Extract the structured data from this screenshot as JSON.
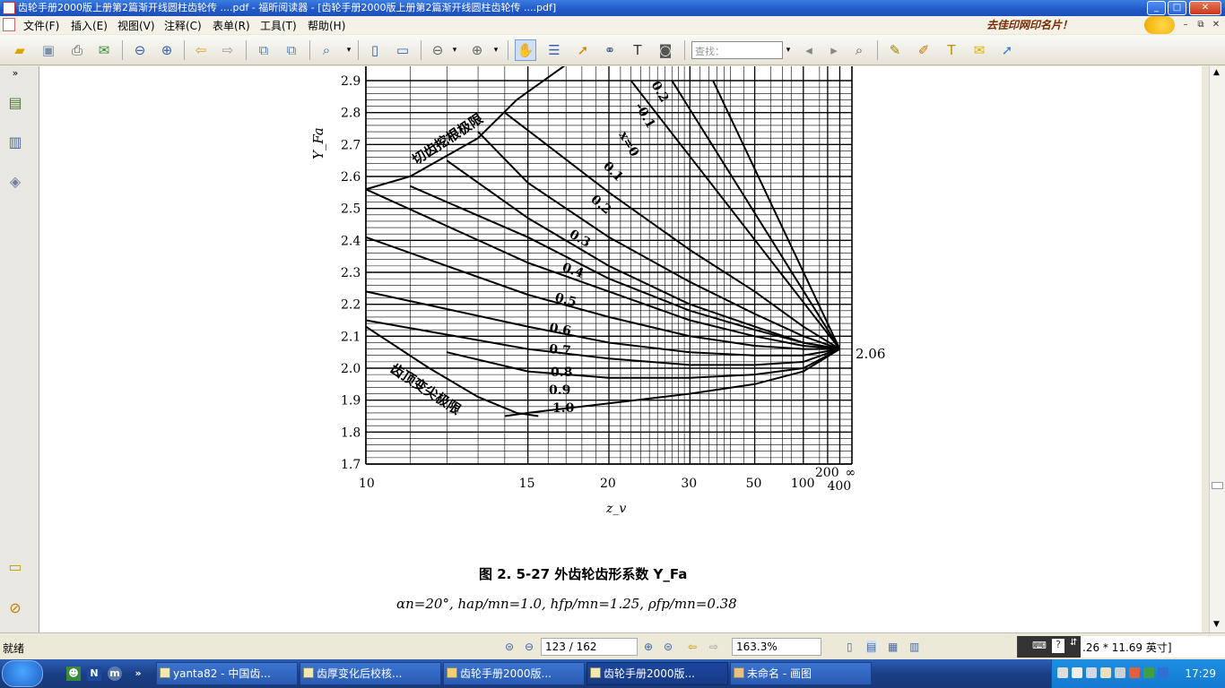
{
  "window": {
    "title": "齿轮手册2000版上册第2篇渐开线圆柱齿轮传 ....pdf - 福昕阅读器 - [齿轮手册2000版上册第2篇渐开线圆柱齿轮传 ....pdf]",
    "min": "_",
    "max": "□",
    "close": "✕"
  },
  "menu": {
    "items": [
      "文件(F)",
      "插入(E)",
      "视图(V)",
      "注释(C)",
      "表单(R)",
      "工具(T)",
      "帮助(H)"
    ],
    "ad_text": "去佳印网印名片！",
    "mdi_min": "–",
    "mdi_restore": "⧉",
    "mdi_close": "✕"
  },
  "toolbar": {
    "search_placeholder": "查找："
  },
  "chart": {
    "y_label": "Y_Fa",
    "x_label": "z_v",
    "y_ticks": [
      "2.9",
      "2.8",
      "2.7",
      "2.6",
      "2.5",
      "2.4",
      "2.3",
      "2.2",
      "2.1",
      "2.0",
      "1.9",
      "1.8",
      "1.7"
    ],
    "x_ticks": [
      "10",
      "15",
      "20",
      "30",
      "50",
      "100",
      "200",
      "400",
      "∞"
    ],
    "limit_top": "切齿挖根极限",
    "limit_bottom": "齿顶变尖极限",
    "endpoint_label": "2.06",
    "curve_labels": [
      "0.2",
      "-0.1",
      "x=0",
      "0.1",
      "0.2",
      "0.3",
      "0.4",
      "0.5",
      "0.6",
      "0.7",
      "0.8",
      "0.9",
      "1.0"
    ],
    "caption": "图 2. 5-27   外齿轮齿形系数 Y_Fa",
    "params": "αn=20°,  hap/mn=1.0,  hfp/mn=1.25,  ρfp/mn=0.38"
  },
  "chart_data": {
    "type": "line",
    "title": "图 2.5-27 外齿轮齿形系数 Y_Fa",
    "xlabel": "z_v",
    "ylabel": "Y_Fa",
    "x_scale": "reciprocal",
    "ylim": [
      1.7,
      2.9
    ],
    "x_ticks": [
      10,
      15,
      20,
      30,
      50,
      100,
      200,
      400,
      "∞"
    ],
    "series": [
      {
        "name": "0.2",
        "x": [
          35,
          400
        ],
        "y": [
          2.9,
          2.06
        ]
      },
      {
        "name": "-0.1",
        "x": [
          27,
          400
        ],
        "y": [
          2.9,
          2.06
        ]
      },
      {
        "name": "x=0",
        "x": [
          22,
          400
        ],
        "y": [
          2.9,
          2.06
        ]
      },
      {
        "name": "0.1",
        "x": [
          14,
          20,
          30,
          50,
          100,
          400
        ],
        "y": [
          2.8,
          2.55,
          2.37,
          2.24,
          2.13,
          2.06
        ]
      },
      {
        "name": "0.2",
        "x": [
          13,
          15,
          20,
          30,
          50,
          100,
          400
        ],
        "y": [
          2.74,
          2.58,
          2.41,
          2.27,
          2.17,
          2.1,
          2.06
        ]
      },
      {
        "name": "0.3",
        "x": [
          12,
          15,
          20,
          30,
          50,
          100,
          400
        ],
        "y": [
          2.65,
          2.47,
          2.32,
          2.2,
          2.13,
          2.08,
          2.06
        ]
      },
      {
        "name": "0.4",
        "x": [
          11,
          15,
          20,
          30,
          50,
          100,
          400
        ],
        "y": [
          2.57,
          2.41,
          2.28,
          2.18,
          2.12,
          2.08,
          2.06
        ]
      },
      {
        "name": "0.5",
        "x": [
          10,
          15,
          20,
          30,
          50,
          100,
          400
        ],
        "y": [
          2.56,
          2.33,
          2.24,
          2.15,
          2.1,
          2.07,
          2.06
        ]
      },
      {
        "name": "0.6",
        "x": [
          10,
          15,
          20,
          30,
          50,
          100,
          400
        ],
        "y": [
          2.41,
          2.23,
          2.16,
          2.1,
          2.07,
          2.06,
          2.06
        ]
      },
      {
        "name": "0.7",
        "x": [
          10,
          15,
          20,
          30,
          50,
          100,
          400
        ],
        "y": [
          2.24,
          2.13,
          2.08,
          2.05,
          2.04,
          2.04,
          2.06
        ]
      },
      {
        "name": "0.8",
        "x": [
          10,
          15,
          20,
          30,
          50,
          100,
          400
        ],
        "y": [
          2.15,
          2.06,
          2.03,
          2.01,
          2.01,
          2.02,
          2.06
        ]
      },
      {
        "name": "0.9",
        "x": [
          12,
          15,
          20,
          30,
          50,
          100,
          400
        ],
        "y": [
          2.05,
          1.99,
          1.97,
          1.97,
          1.98,
          2.0,
          2.06
        ]
      },
      {
        "name": "1.0",
        "x": [
          14,
          15,
          20,
          30,
          50,
          100,
          400
        ],
        "y": [
          1.85,
          1.86,
          1.89,
          1.92,
          1.95,
          1.99,
          2.06
        ]
      }
    ],
    "annotations": [
      "切齿挖根极限",
      "齿顶变尖极限",
      "2.06"
    ]
  },
  "status": {
    "ready": "就绪",
    "page": "123 / 162",
    "zoom": "163.3%",
    "size": ".26 * 11.69 英寸]"
  },
  "taskbar": {
    "tasks": [
      "yanta82 - 中国齿...",
      "齿厚变化后校核...",
      "齿轮手册2000版...",
      "齿轮手册2000版...",
      "未命名 - 画图"
    ],
    "clock": "17:29"
  }
}
